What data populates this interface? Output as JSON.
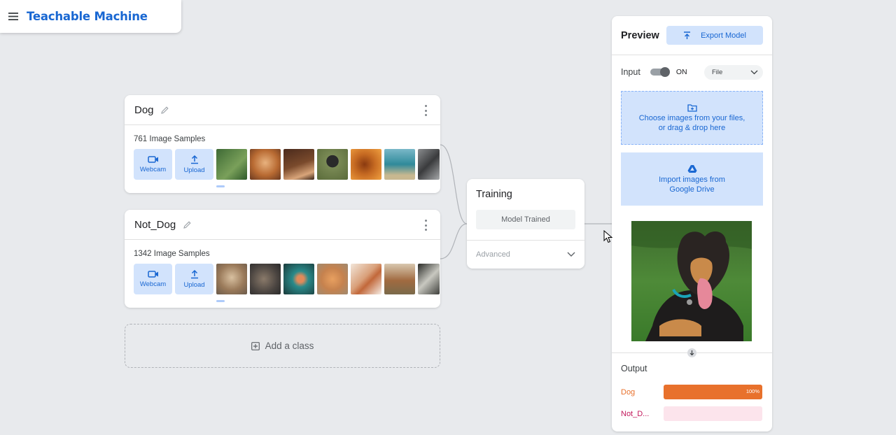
{
  "app": {
    "title": "Teachable Machine"
  },
  "classes": [
    {
      "name": "Dog",
      "samples_label": "761 Image Samples",
      "webcam_label": "Webcam",
      "upload_label": "Upload",
      "thumbs": [
        "#4a7a3f",
        "#c9814a",
        "#6a3a26",
        "#5d6b3e",
        "#b5621e",
        "#2f8a9a",
        "#595b5e"
      ]
    },
    {
      "name": "Not_Dog",
      "samples_label": "1342 Image Samples",
      "webcam_label": "Webcam",
      "upload_label": "Upload",
      "thumbs": [
        "#b79f85",
        "#6b625a",
        "#2c6a6a",
        "#c6824e",
        "#d9a07a",
        "#a98b6b",
        "#3f403c"
      ]
    }
  ],
  "add_class": {
    "label": "Add a class"
  },
  "training": {
    "title": "Training",
    "button_label": "Model Trained",
    "advanced_label": "Advanced"
  },
  "preview": {
    "title": "Preview",
    "export_label": "Export Model",
    "input_label": "Input",
    "toggle_state": "ON",
    "source_selected": "File",
    "drop_zone_line1": "Choose images from your files,",
    "drop_zone_line2": "or drag & drop here",
    "drive_line1": "Import images from",
    "drive_line2": "Google Drive",
    "output_title": "Output",
    "outputs": [
      {
        "label": "Dog",
        "value": 1.0,
        "percent_text": "100%",
        "color": "#e8712c",
        "bg": "#fde7d9"
      },
      {
        "label": "Not_D...",
        "value": 0.0,
        "percent_text": "",
        "color": "#c2185b",
        "bg": "#fce4ec"
      }
    ]
  },
  "colors": {
    "accent": "#1967d2",
    "accent_light": "#d2e3fc",
    "background": "#e8eaed"
  }
}
